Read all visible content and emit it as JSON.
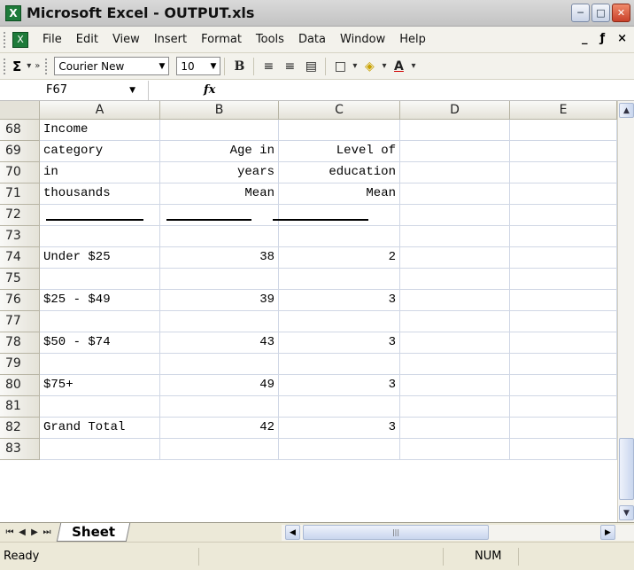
{
  "window": {
    "title": "Microsoft Excel - OUTPUT.xls",
    "app_icon": "X",
    "controls": [
      "minimize-icon",
      "maximize-icon",
      "close-icon"
    ]
  },
  "menu": {
    "items": [
      "File",
      "Edit",
      "View",
      "Insert",
      "Format",
      "Tools",
      "Data",
      "Window",
      "Help"
    ],
    "right_controls": [
      "_",
      "ƒ",
      "×"
    ]
  },
  "toolbar": {
    "autosum": "Σ",
    "font_name": "Courier New",
    "font_size": "10",
    "bold": "B"
  },
  "formula_bar": {
    "name_box": "F67",
    "fx": "fx"
  },
  "grid": {
    "columns": [
      "A",
      "B",
      "C",
      "D",
      "E"
    ],
    "rows": [
      {
        "n": "68",
        "a": "Income",
        "b": "",
        "c": ""
      },
      {
        "n": "69",
        "a": "category",
        "b": "Age in",
        "c": "Level of"
      },
      {
        "n": "70",
        "a": "in",
        "b": "years",
        "c": "education"
      },
      {
        "n": "71",
        "a": "thousands",
        "b": "Mean",
        "c": "Mean"
      },
      {
        "n": "72",
        "a": "",
        "b": "",
        "c": ""
      },
      {
        "n": "73",
        "a": "",
        "b": "",
        "c": ""
      },
      {
        "n": "74",
        "a": "Under $25",
        "b": "38",
        "c": "2"
      },
      {
        "n": "75",
        "a": "",
        "b": "",
        "c": ""
      },
      {
        "n": "76",
        "a": "$25 - $49",
        "b": "39",
        "c": "3"
      },
      {
        "n": "77",
        "a": "",
        "b": "",
        "c": ""
      },
      {
        "n": "78",
        "a": "$50 - $74",
        "b": "43",
        "c": "3"
      },
      {
        "n": "79",
        "a": "",
        "b": "",
        "c": ""
      },
      {
        "n": "80",
        "a": "$75+",
        "b": "49",
        "c": "3"
      },
      {
        "n": "81",
        "a": "",
        "b": "",
        "c": ""
      },
      {
        "n": "82",
        "a": "Grand Total",
        "b": "42",
        "c": "3"
      },
      {
        "n": "83",
        "a": "",
        "b": "",
        "c": ""
      }
    ]
  },
  "sheet_tabs": {
    "active": "Sheet"
  },
  "status": {
    "ready": "Ready",
    "num": "NUM"
  }
}
